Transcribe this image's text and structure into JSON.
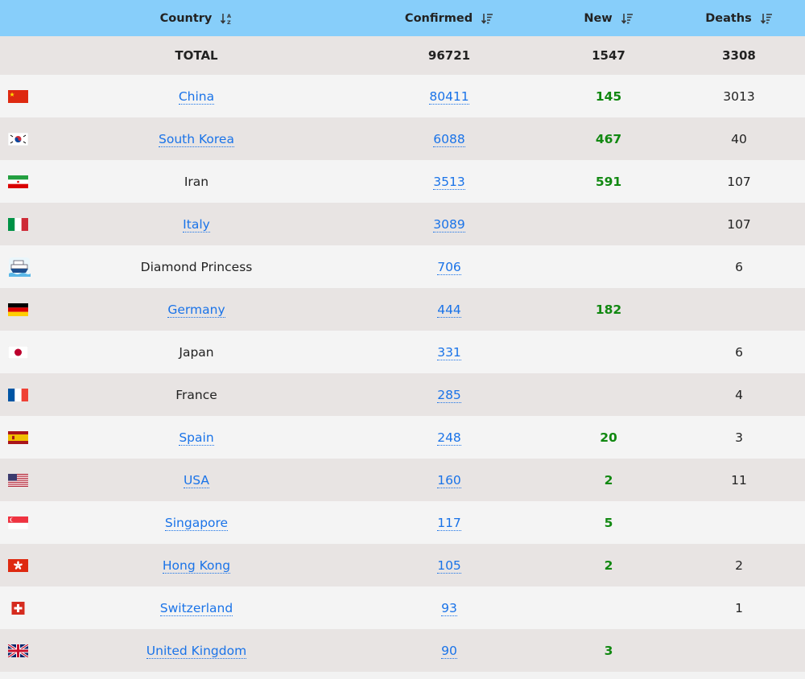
{
  "header": {
    "country": "Country",
    "confirmed": "Confirmed",
    "new": "New",
    "deaths": "Deaths"
  },
  "total": {
    "label": "TOTAL",
    "confirmed": "96721",
    "new": "1547",
    "deaths": "3308"
  },
  "rows": [
    {
      "flag": "china-flag-icon",
      "country": "China",
      "link": true,
      "confirmed": "80411",
      "new": "145",
      "deaths": "3013"
    },
    {
      "flag": "south-korea-flag-icon",
      "country": "South Korea",
      "link": true,
      "confirmed": "6088",
      "new": "467",
      "deaths": "40"
    },
    {
      "flag": "iran-flag-icon",
      "country": "Iran",
      "link": false,
      "confirmed": "3513",
      "new": "591",
      "deaths": "107"
    },
    {
      "flag": "italy-flag-icon",
      "country": "Italy",
      "link": true,
      "confirmed": "3089",
      "new": "",
      "deaths": "107"
    },
    {
      "flag": "cruise-ship-icon",
      "country": "Diamond Princess",
      "link": false,
      "confirmed": "706",
      "new": "",
      "deaths": "6"
    },
    {
      "flag": "germany-flag-icon",
      "country": "Germany",
      "link": true,
      "confirmed": "444",
      "new": "182",
      "deaths": ""
    },
    {
      "flag": "japan-flag-icon",
      "country": "Japan",
      "link": false,
      "confirmed": "331",
      "new": "",
      "deaths": "6"
    },
    {
      "flag": "france-flag-icon",
      "country": "France",
      "link": false,
      "confirmed": "285",
      "new": "",
      "deaths": "4"
    },
    {
      "flag": "spain-flag-icon",
      "country": "Spain",
      "link": true,
      "confirmed": "248",
      "new": "20",
      "deaths": "3"
    },
    {
      "flag": "usa-flag-icon",
      "country": "USA",
      "link": true,
      "confirmed": "160",
      "new": "2",
      "deaths": "11"
    },
    {
      "flag": "singapore-flag-icon",
      "country": "Singapore",
      "link": true,
      "confirmed": "117",
      "new": "5",
      "deaths": ""
    },
    {
      "flag": "hong-kong-flag-icon",
      "country": "Hong Kong",
      "link": true,
      "confirmed": "105",
      "new": "2",
      "deaths": "2"
    },
    {
      "flag": "switzerland-flag-icon",
      "country": "Switzerland",
      "link": true,
      "confirmed": "93",
      "new": "",
      "deaths": "1"
    },
    {
      "flag": "uk-flag-icon",
      "country": "United Kingdom",
      "link": true,
      "confirmed": "90",
      "new": "3",
      "deaths": ""
    }
  ],
  "colors": {
    "header_bg": "#87cefa",
    "link": "#1a73e8",
    "new_cases": "#118811",
    "row_light": "#f4f4f4",
    "row_dark": "#e8e4e3"
  }
}
